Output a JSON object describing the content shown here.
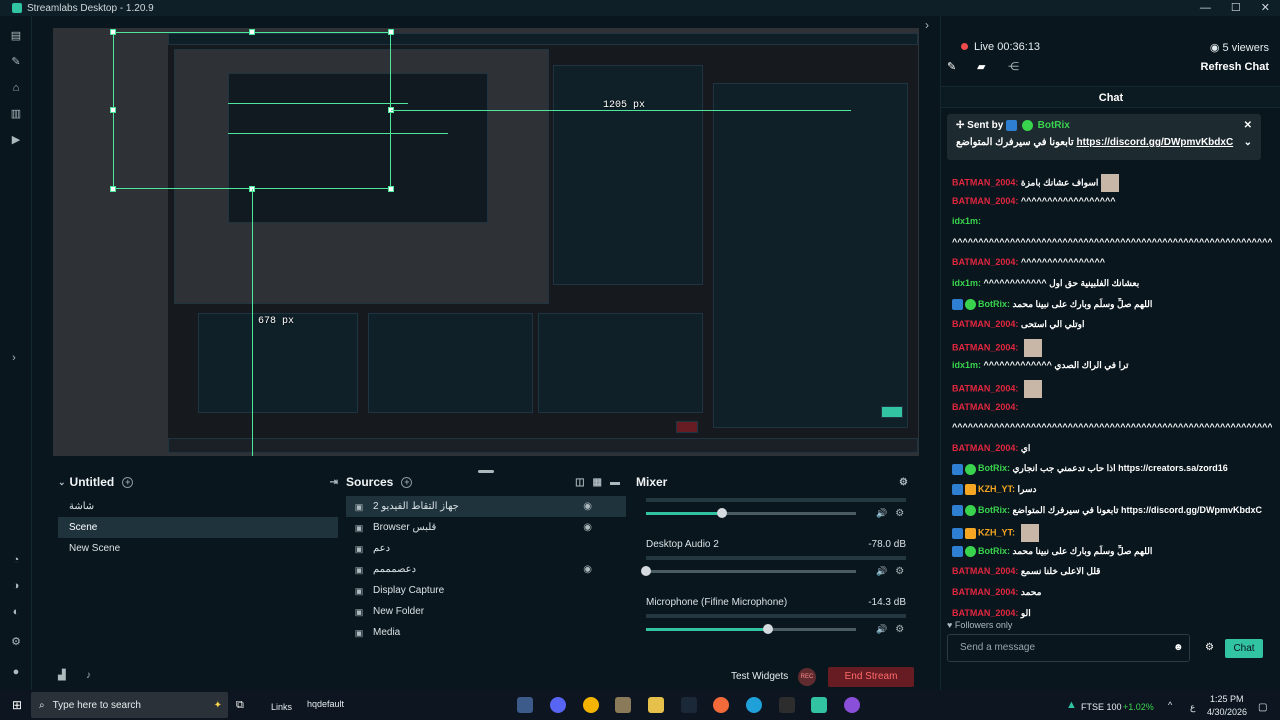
{
  "window": {
    "title": "Streamlabs Desktop - 1.20.9",
    "controls": [
      "—",
      "☐",
      "✕"
    ]
  },
  "preview": {
    "width_label": "1205 px",
    "height_label": "678 px"
  },
  "scenes": {
    "title": "Untitled",
    "items": [
      "شاشة",
      "Scene",
      "New Scene"
    ],
    "active": 1
  },
  "sources": {
    "title": "Sources",
    "items": [
      {
        "label": "جهاز التقاط الفيديو 2",
        "eye": true
      },
      {
        "label": "Browser قلبس",
        "eye": true
      },
      {
        "label": "دعم",
        "eye": false
      },
      {
        "label": "دعصمممم",
        "eye": true
      },
      {
        "label": "Display Capture",
        "eye": false
      },
      {
        "label": "New Folder",
        "eye": false
      },
      {
        "label": "Media",
        "eye": false
      }
    ]
  },
  "mixer": {
    "title": "Mixer",
    "channels": [
      {
        "name": "",
        "db": "",
        "level": 0.36
      },
      {
        "name": "Desktop Audio 2",
        "db": "-78.0 dB",
        "level": 0.0
      },
      {
        "name": "Microphone (Fifine Microphone)",
        "db": "-14.3 dB",
        "level": 0.58
      }
    ]
  },
  "footer": {
    "test_widgets": "Test Widgets",
    "rec": "REC",
    "end_stream": "End Stream"
  },
  "chat": {
    "live": "Live 00:36:13",
    "viewers": "5 viewers",
    "refresh": "Refresh Chat",
    "header": "Chat",
    "pinned_sender_label": "Sent by",
    "pinned_sender": "BotRix",
    "pinned_text": "تابعونا في سيرفرك المتواضع",
    "pinned_link": "https://discord.gg/DWpmvKbdxC",
    "followers_only": "Followers only",
    "input_placeholder": "Send a message",
    "send": "Chat",
    "messages": [
      {
        "user": "BATMAN_2004",
        "color": "#e2263f",
        "text": "اسواف عشانك بامزة",
        "emote": true
      },
      {
        "user": "BATMAN_2004",
        "color": "#e2263f",
        "text": "^^^^^^^^^^^^^^^^^^",
        "emote": false
      },
      {
        "user": "idx1m",
        "color": "#39d34e",
        "text": "",
        "emote": false
      },
      {
        "user": "",
        "color": "#ffffff",
        "text": "^^^^^^^^^^^^^^^^^^^^^^^^^^^^^^^^^^^^^^^^^^^^^^^^^^^^^^^^^^^^^^^^^^^^^^^^^^^",
        "emote": false
      },
      {
        "user": "BATMAN_2004",
        "color": "#e2263f",
        "text": "^^^^^^^^^^^^^^^^",
        "emote": false
      },
      {
        "user": "idx1m",
        "color": "#39d34e",
        "text": "^^^^^^^^^^^^ بعشانك الفلبينية حق اول",
        "emote": false
      },
      {
        "user": "BotRix",
        "color": "#39d34e",
        "text": "اللهم صلِّ وسلِّم وبارك على نبينا محمد",
        "emote": false
      },
      {
        "user": "BATMAN_2004",
        "color": "#e2263f",
        "text": "اوتلي الي استحى",
        "emote": false
      },
      {
        "user": "BATMAN_2004",
        "color": "#e2263f",
        "text": "",
        "emote": true
      },
      {
        "user": "idx1m",
        "color": "#39d34e",
        "text": "^^^^^^^^^^^^^ ترا في الراك الصدي",
        "emote": false
      },
      {
        "user": "BATMAN_2004",
        "color": "#e2263f",
        "text": "",
        "emote": true
      },
      {
        "user": "BATMAN_2004",
        "color": "#e2263f",
        "text": "",
        "emote": false
      },
      {
        "user": "",
        "color": "#ffffff",
        "text": "^^^^^^^^^^^^^^^^^^^^^^^^^^^^^^^^^^^^^^^^^^^^^^^^^^^^^^^^^^^^^^^^^^^^^^^^^",
        "emote": false
      },
      {
        "user": "BATMAN_2004",
        "color": "#e2263f",
        "text": "اي",
        "emote": false
      },
      {
        "user": "BotRix",
        "color": "#39d34e",
        "text": "اذا حاب تدعمني جب انجاري https://creators.sa/zord16",
        "emote": false
      },
      {
        "user": "KZH_YT",
        "color": "#f5a623",
        "text": "دسرا",
        "emote": false
      },
      {
        "user": "BotRix",
        "color": "#39d34e",
        "text": "تابعونا في سيرفرك المتواضع https://discord.gg/DWpmvKbdxC",
        "emote": false
      },
      {
        "user": "KZH_YT",
        "color": "#f5a623",
        "text": "",
        "emote": true
      },
      {
        "user": "BotRix",
        "color": "#39d34e",
        "text": "اللهم صلِّ وسلِّم وبارك على نبينا محمد",
        "emote": false
      },
      {
        "user": "BATMAN_2004",
        "color": "#e2263f",
        "text": "قلل الاعلى خلنا نسمع",
        "emote": false
      },
      {
        "user": "BATMAN_2004",
        "color": "#e2263f",
        "text": "محمد",
        "emote": false
      },
      {
        "user": "BATMAN_2004",
        "color": "#e2263f",
        "text": "الو",
        "emote": false
      }
    ]
  },
  "taskbar": {
    "search_placeholder": "Type here to search",
    "links": "Links",
    "file": "hqdefault",
    "ticker": "FTSE 100",
    "ticker_change": "+1.02%",
    "time": "1:25 PM",
    "date": "4/30/2026",
    "lang": "ع"
  }
}
